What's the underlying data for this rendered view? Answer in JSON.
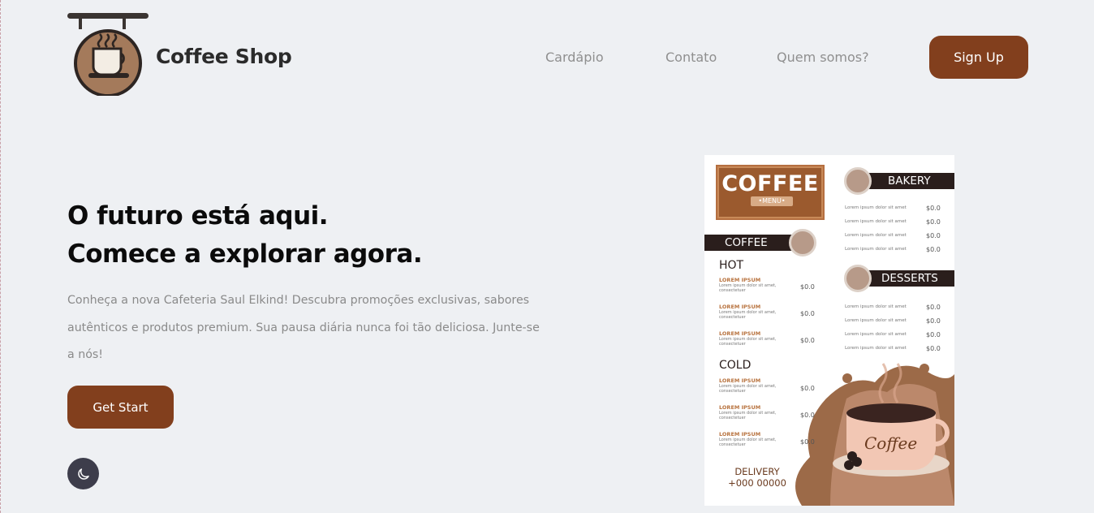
{
  "header": {
    "brand": "Coffee Shop",
    "logo_icon": "hanging-coffee-sign-icon",
    "nav": [
      "Cardápio",
      "Contato",
      "Quem somos?"
    ],
    "signup_label": "Sign Up"
  },
  "hero": {
    "headline_1": "O futuro está aqui.",
    "headline_2": "Comece a explorar agora.",
    "description": "Conheça a nova Cafeteria Saul Elkind! Descubra promoções exclusivas, sabores autênticos e produtos premium. Sua pausa diária nunca foi tão deliciosa. Junte-se a nós!",
    "cta_label": "Get Start",
    "theme_toggle_icon": "moon-icon"
  },
  "menu_card": {
    "title": "COFFEE",
    "subtitle": "•MENU•",
    "coffee_section": "COFFEE",
    "hot": "HOT",
    "cold": "COLD",
    "item_name": "LOREM IPSUM",
    "item_desc": "Lorem ipsum dolor sit amet, consectetuer",
    "price": "$0.0",
    "bakery": "BAKERY",
    "desserts": "DESSERTS",
    "side_line": "Lorem ipsum dolor sit amet",
    "cup_text": "Coffee",
    "delivery": "DELIVERY",
    "phone": "+000 00000"
  },
  "colors": {
    "accent": "#823f1d",
    "background": "#eef0f3",
    "toggle": "#3d3d4b"
  }
}
